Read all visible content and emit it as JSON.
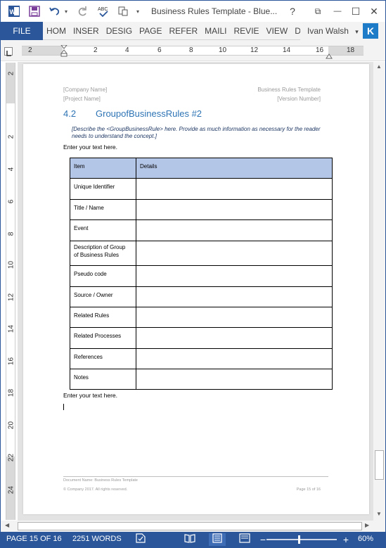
{
  "titlebar": {
    "title": "Business Rules Template - Blue...",
    "help": "?",
    "restore": "⧉",
    "minimize": "—",
    "maximize": "☐",
    "close": "✕"
  },
  "ribbon": {
    "file": "FILE",
    "tabs": [
      "HOM",
      "INSER",
      "DESIG",
      "PAGE",
      "REFER",
      "MAILI",
      "REVIE",
      "VIEW",
      "DEVE"
    ],
    "user": "Ivan Walsh",
    "user_initial": "K",
    "accent": "#2b579a"
  },
  "ruler": {
    "h_numbers": [
      "2",
      "2",
      "4",
      "6",
      "8",
      "10",
      "12",
      "14",
      "16",
      "18"
    ],
    "v_numbers": [
      "2",
      "2",
      "4",
      "6",
      "8",
      "10",
      "12",
      "14",
      "16",
      "18",
      "20",
      "22",
      "24"
    ]
  },
  "document": {
    "header_left_1": "[Company Name]",
    "header_left_2": "[Project Name]",
    "header_right_1": "Business Rules Template",
    "header_right_2": "[Version Number]",
    "heading_number": "4.2",
    "heading_text": "GroupofBusinessRules #2",
    "instructions": "[Describe the <GroupBusinessRule> here. Provide as much information as necessary for the reader needs to understand the concept.]",
    "intro_text": "Enter your text here.",
    "outro_text": "Enter your text here.",
    "table": {
      "headers": [
        "Item",
        "Details"
      ],
      "header_color": "#b4c6e7",
      "rows": [
        "Unique Identifier",
        "Title / Name",
        "Event",
        "Description of Group of Business Rules",
        "Pseudo code",
        "Source / Owner",
        "Related Rules",
        "Related Processes",
        "References",
        "Notes"
      ]
    },
    "footer_doc_name": "Document Name: Business Rules Template",
    "footer_copyright": "© Company 2017. All rights reserved.",
    "footer_page": "Page 15 of 16"
  },
  "status": {
    "page": "PAGE 15 OF 16",
    "words": "2251 WORDS",
    "zoom": "60%"
  }
}
